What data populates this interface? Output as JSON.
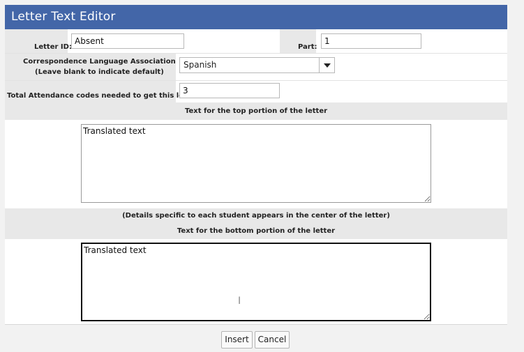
{
  "dialog": {
    "title": "Letter Text Editor"
  },
  "fields": {
    "letter_id_label": "Letter ID:",
    "letter_id_value": "Absent",
    "part_label": "Part:",
    "part_value": "1",
    "language_label_line1": "Correspondence Language Association",
    "language_label_line2": "(Leave blank to indicate default)",
    "language_value": "Spanish",
    "codes_label": "Total Attendance codes needed to get this letter:",
    "codes_value": "3"
  },
  "sections": {
    "top_heading": "Text for the top portion of the letter",
    "top_text": "Translated text",
    "middle_note": "(Details specific to each student appears in the center of the letter)",
    "bottom_heading": "Text for the bottom portion of the letter",
    "bottom_text": "Translated text"
  },
  "buttons": {
    "insert": "Insert",
    "cancel": "Cancel"
  },
  "icons": {
    "dropdown": "chevron-down-icon",
    "cursor": "text-cursor-icon"
  },
  "colors": {
    "titlebar": "#4366a8",
    "section_gray": "#e8e8e8"
  }
}
